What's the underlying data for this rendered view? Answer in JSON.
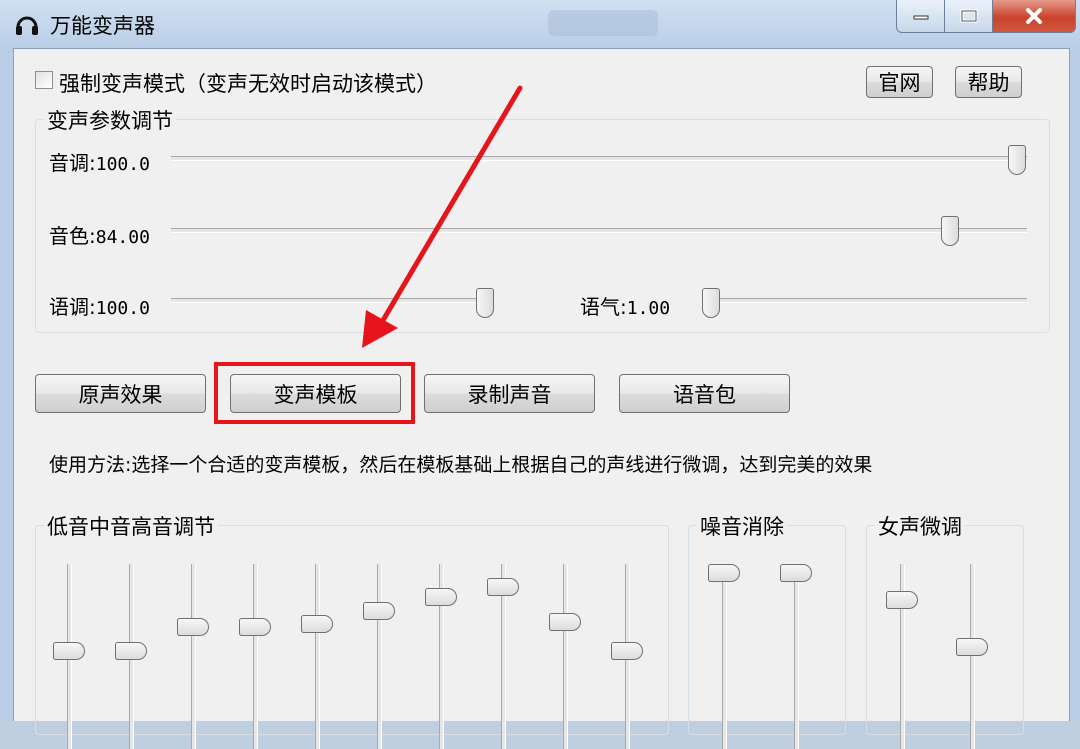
{
  "window": {
    "title": "万能变声器",
    "buttons": {
      "minimize": "minimize",
      "maximize": "maximize",
      "close": "close"
    }
  },
  "top": {
    "force_mode_label": "强制变声模式（变声无效时启动该模式）",
    "force_mode_checked": false,
    "website_button": "官网",
    "help_button": "帮助"
  },
  "params_group": {
    "title": "变声参数调节",
    "pitch": {
      "label": "音调:",
      "value": "100.0",
      "level": 1.0
    },
    "timbre": {
      "label": "音色:",
      "value": "84.00",
      "level": 0.9
    },
    "intonation": {
      "label": "语调:",
      "value": "100.0",
      "level": 1.0
    },
    "tone": {
      "label": "语气:",
      "value": "1.00",
      "level": 0.0
    }
  },
  "mode_buttons": [
    "原声效果",
    "变声模板",
    "录制声音",
    "语音包"
  ],
  "usage_text": "使用方法:选择一个合适的变声模板，然后在模板基础上根据自己的声线进行微调，达到完美的效果",
  "eq_group": {
    "title": "低音中音高音调节",
    "levels": [
      0.42,
      0.42,
      0.6,
      0.6,
      0.62,
      0.72,
      0.82,
      0.9,
      0.64,
      0.42
    ]
  },
  "noise_group": {
    "title": "噪音消除",
    "levels": [
      1.0,
      1.0
    ]
  },
  "female_group": {
    "title": "女声微调",
    "levels": [
      0.8,
      0.45
    ]
  },
  "colors": {
    "highlight": "#e6141b",
    "arrow": "#e6141b"
  },
  "icons": {
    "app": "headphones-icon"
  }
}
